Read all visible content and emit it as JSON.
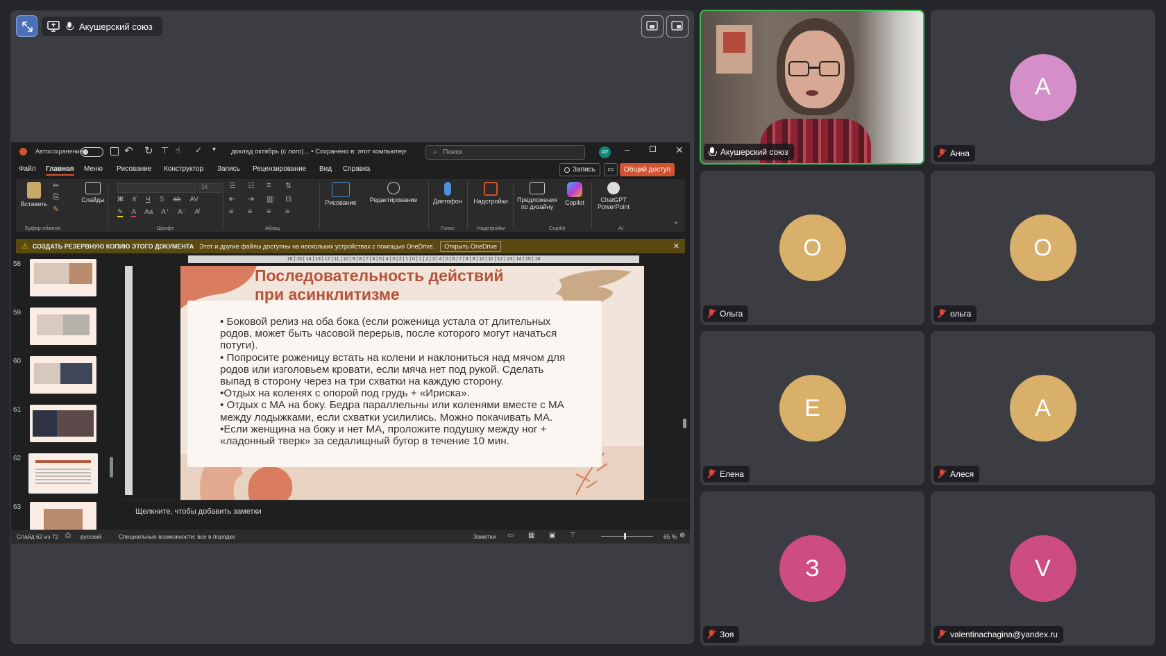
{
  "colors": {
    "bg": "#26272b",
    "tile": "#3c3d42",
    "active_speaker": "#3dbe55",
    "slide_title": "#b5543a"
  },
  "meeting": {
    "speaker_name": "Акушерский союз"
  },
  "participants": [
    {
      "name": "Анна",
      "initial": "А",
      "color": "#d48fc9"
    },
    {
      "name": "Ольга",
      "initial": "О",
      "color": "#d9b06a"
    },
    {
      "name": "ольга",
      "initial": "О",
      "color": "#d9b06a"
    },
    {
      "name": "Елена",
      "initial": "Е",
      "color": "#d9b06a"
    },
    {
      "name": "Алеся",
      "initial": "А",
      "color": "#d9b06a"
    },
    {
      "name": "Зоя",
      "initial": "З",
      "color": "#cd4c82"
    },
    {
      "name": "valentinachagina@yandex.ru",
      "initial": "V",
      "color": "#cd4c82"
    }
  ],
  "ppt": {
    "autosave": "Автосохранение",
    "doc_title": "доклад октябрь (с лого)... • Сохранено в: этот компьютер",
    "search_placeholder": "Поиск",
    "user_initials": "АУ",
    "menu": [
      "Файл",
      "Главная",
      "Меню",
      "Рисование",
      "Конструктор",
      "Запись",
      "Рецензирование",
      "Вид",
      "Справка"
    ],
    "record_btn": "Запись",
    "share_btn": "Общий доступ",
    "ribbon": {
      "paste": "Вставить",
      "slides": "Слайды",
      "draw": "Рисование",
      "edit": "Редактирование",
      "dictate": "Диктофон",
      "addins": "Надстройки",
      "designer": "Предложения по дизайну",
      "copilot": "Copilot",
      "chatgpt": "ChatGPT PowerPoint",
      "font_size": "24"
    },
    "groups": {
      "clipboard": "Буфер обмена",
      "font": "Шрифт",
      "paragraph": "Абзац",
      "voice": "Голос",
      "addins": "Надстройки",
      "copilot": "Copilot",
      "ai": "AI"
    },
    "notice": {
      "title": "СОЗДАТЬ РЕЗЕРВНУЮ КОПИЮ ЭТОГО ДОКУМЕНТА",
      "text": "Этот и другие файлы доступны на нескольких устройствах с помощью OneDrive.",
      "button": "Открыть OneDrive"
    },
    "thumb_numbers": [
      "58",
      "59",
      "60",
      "61",
      "62",
      "63"
    ],
    "ruler": "16 | 15 | 14 | 13 | 12 | 11 | 10 | 9 | 8 | 7 | 6 | 5 | 4 | 3 | 2 | 1 | 0 | 1 | 2 | 3 | 4 | 5 | 6 | 7 | 8 | 9 | 10 | 11 | 12 | 13 | 14 | 15 | 16",
    "slide": {
      "title_line1": "Последовательность действий",
      "title_line2": "при асинклитизме",
      "bullets": [
        "• Боковой релиз на оба бока (если роженица устала от длительных родов, может быть часовой перерыв, после которого могут начаться потуги).",
        "• Попросите роженицу встать на колени и наклониться над мячом для родов или изголовьем кровати, если мяча нет под рукой. Сделать выпад в сторону через на три схватки на каждую сторону.",
        "•Отдых на коленях с опорой под грудь + «Ириска».",
        "• Отдых с МА на боку. Бедра параллельны или коленями вместе с МА между лодыжками, если схватки усилились. Можно покачивать МА.",
        "•Если женщина на боку и нет МА, проложите подушку между ног + «ладонный тверк» за седалищный бугор в течение 10 мин."
      ]
    },
    "notes_placeholder": "Щелкните, чтобы добавить заметки",
    "status": {
      "slide": "Слайд 62 из 72",
      "lang": "русский",
      "a11y": "Специальные возможности: все в порядке",
      "notes": "Заметки",
      "zoom": "65 %"
    }
  }
}
